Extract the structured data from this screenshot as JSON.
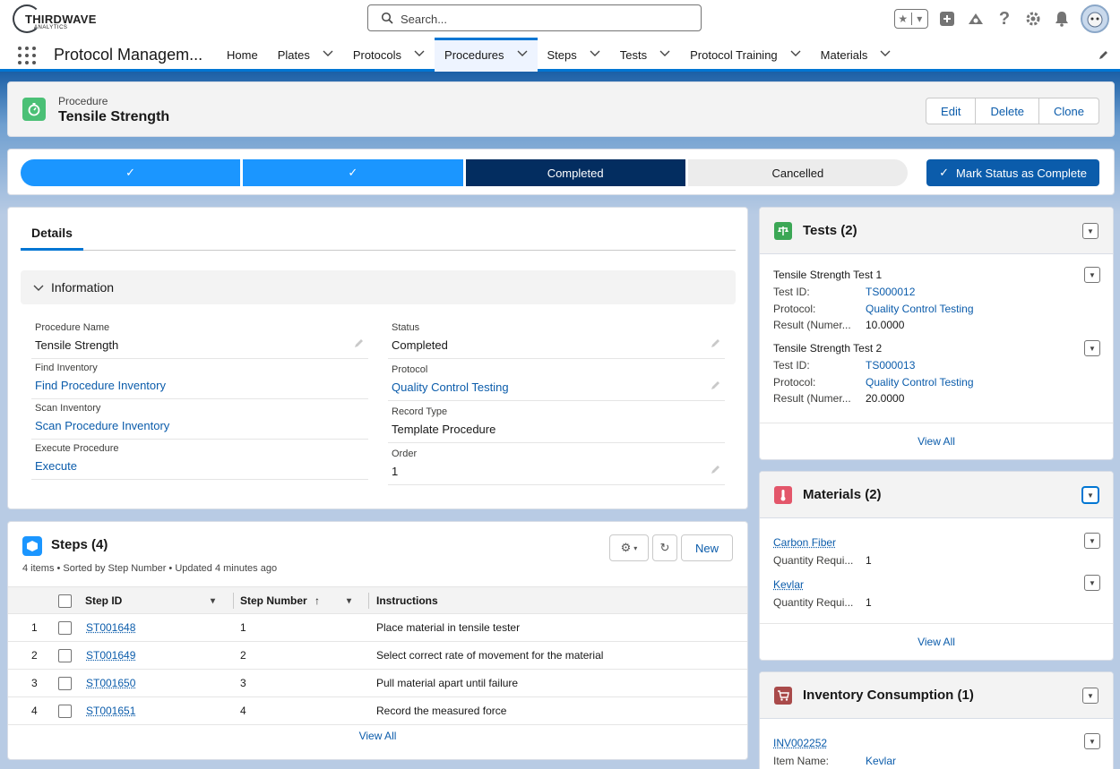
{
  "header": {
    "logo": {
      "main": "THIRDWAVE",
      "sub": "ANALYTICS"
    },
    "search_placeholder": "Search..."
  },
  "nav": {
    "app_name": "Protocol Managem...",
    "items": [
      {
        "label": "Home",
        "has_menu": false
      },
      {
        "label": "Plates",
        "has_menu": true
      },
      {
        "label": "Protocols",
        "has_menu": true
      },
      {
        "label": "Procedures",
        "has_menu": true,
        "active": true
      },
      {
        "label": "Steps",
        "has_menu": true
      },
      {
        "label": "Tests",
        "has_menu": true
      },
      {
        "label": "Protocol Training",
        "has_menu": true
      },
      {
        "label": "Materials",
        "has_menu": true
      }
    ]
  },
  "record": {
    "type": "Procedure",
    "title": "Tensile Strength",
    "buttons": [
      "Edit",
      "Delete",
      "Clone"
    ]
  },
  "path": {
    "stages": [
      {
        "label": "✓",
        "state": "done"
      },
      {
        "label": "✓",
        "state": "done"
      },
      {
        "label": "Completed",
        "state": "current"
      },
      {
        "label": "Cancelled",
        "state": "todo"
      }
    ],
    "action_label": "Mark Status as Complete"
  },
  "details": {
    "tab": "Details",
    "section": "Information",
    "left_fields": [
      {
        "label": "Procedure Name",
        "value": "Tensile Strength",
        "link": false,
        "editable": true
      },
      {
        "label": "Find Inventory",
        "value": "Find Procedure Inventory",
        "link": true,
        "editable": false
      },
      {
        "label": "Scan Inventory",
        "value": "Scan Procedure Inventory",
        "link": true,
        "editable": false
      },
      {
        "label": "Execute Procedure",
        "value": "Execute",
        "link": true,
        "editable": false
      }
    ],
    "right_fields": [
      {
        "label": "Status",
        "value": "Completed",
        "link": false,
        "editable": true
      },
      {
        "label": "Protocol",
        "value": "Quality Control Testing",
        "link": true,
        "editable": true
      },
      {
        "label": "Record Type",
        "value": "Template Procedure",
        "link": false,
        "editable": false
      },
      {
        "label": "Order",
        "value": "1",
        "link": false,
        "editable": true
      }
    ]
  },
  "steps": {
    "title": "Steps (4)",
    "info": "4 items • Sorted by Step Number • Updated 4 minutes ago",
    "new_label": "New",
    "columns": [
      "Step ID",
      "Step Number",
      "Instructions"
    ],
    "sort_indicator": "↑",
    "rows": [
      {
        "n": "1",
        "id": "ST001648",
        "num": "1",
        "instr": "Place material in tensile tester"
      },
      {
        "n": "2",
        "id": "ST001649",
        "num": "2",
        "instr": "Select correct rate of movement for the material"
      },
      {
        "n": "3",
        "id": "ST001650",
        "num": "3",
        "instr": "Pull material apart until failure"
      },
      {
        "n": "4",
        "id": "ST001651",
        "num": "4",
        "instr": "Record the measured force"
      }
    ],
    "view_all": "View All"
  },
  "tests": {
    "title": "Tests (2)",
    "items": [
      {
        "name": "Tensile Strength Test 1",
        "id_label": "Test ID:",
        "id": "TS000012",
        "protocol_label": "Protocol:",
        "protocol": "Quality Control Testing",
        "result_label": "Result (Numer...",
        "result": "10.0000"
      },
      {
        "name": "Tensile Strength Test 2",
        "id_label": "Test ID:",
        "id": "TS000013",
        "protocol_label": "Protocol:",
        "protocol": "Quality Control Testing",
        "result_label": "Result (Numer...",
        "result": "20.0000"
      }
    ],
    "view_all": "View All"
  },
  "materials": {
    "title": "Materials (2)",
    "items": [
      {
        "name": "Carbon Fiber",
        "qty_label": "Quantity Requi...",
        "qty": "1"
      },
      {
        "name": "Kevlar",
        "qty_label": "Quantity Requi...",
        "qty": "1"
      }
    ],
    "view_all": "View All"
  },
  "inventory": {
    "title": "Inventory Consumption (1)",
    "items": [
      {
        "id": "INV002252",
        "name_label": "Item Name:",
        "name": "Kevlar"
      }
    ]
  },
  "colors": {
    "brand_blue": "#0176d3",
    "link": "#0b5cab",
    "path_done": "#1b96ff",
    "path_current": "#032d60",
    "procedure_icon": "#4bc076",
    "tests_icon": "#3ba755",
    "materials_icon": "#e3566a",
    "inventory_icon": "#a94a4a"
  }
}
